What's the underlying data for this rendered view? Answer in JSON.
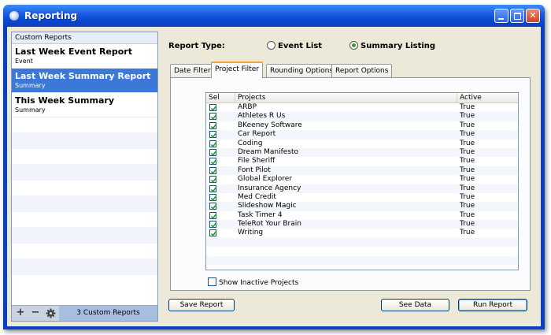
{
  "window": {
    "title": "Reporting"
  },
  "sidebar": {
    "header": "Custom Reports",
    "items": [
      {
        "name": "Last Week Event Report",
        "type": "Event",
        "selected": false
      },
      {
        "name": "Last Week Summary Report",
        "type": "Summary",
        "selected": true
      },
      {
        "name": "This Week Summary",
        "type": "Summary",
        "selected": false
      }
    ],
    "footer": {
      "count_label": "3 Custom Reports"
    }
  },
  "report_type": {
    "label": "Report Type:",
    "options": [
      {
        "label": "Event List",
        "selected": false
      },
      {
        "label": "Summary Listing",
        "selected": true
      }
    ]
  },
  "tabs": [
    {
      "label": "Date Filter",
      "active": false
    },
    {
      "label": "Project Filter",
      "active": true
    },
    {
      "label": "Rounding Options",
      "active": false
    },
    {
      "label": "Report Options",
      "active": false
    }
  ],
  "grid": {
    "columns": {
      "sel": "Sel",
      "projects": "Projects",
      "active": "Active"
    },
    "rows": [
      {
        "project": "ARBP",
        "active": "True",
        "selected": true
      },
      {
        "project": "Athletes R Us",
        "active": "True",
        "selected": true
      },
      {
        "project": "BKeeney Software",
        "active": "True",
        "selected": true
      },
      {
        "project": "Car Report",
        "active": "True",
        "selected": true
      },
      {
        "project": "Coding",
        "active": "True",
        "selected": true
      },
      {
        "project": "Dream Manifesto",
        "active": "True",
        "selected": true
      },
      {
        "project": "File Sheriff",
        "active": "True",
        "selected": true
      },
      {
        "project": "Font Pilot",
        "active": "True",
        "selected": true
      },
      {
        "project": "Global Explorer",
        "active": "True",
        "selected": true
      },
      {
        "project": "Insurance Agency",
        "active": "True",
        "selected": true
      },
      {
        "project": "Med Credit",
        "active": "True",
        "selected": true
      },
      {
        "project": "Slideshow Magic",
        "active": "True",
        "selected": true
      },
      {
        "project": "Task Timer 4",
        "active": "True",
        "selected": true
      },
      {
        "project": "TeleRot Your Brain",
        "active": "True",
        "selected": true
      },
      {
        "project": "Writing",
        "active": "True",
        "selected": true
      }
    ]
  },
  "show_inactive": {
    "label": "Show Inactive Projects",
    "checked": false
  },
  "buttons": {
    "save": "Save Report",
    "see_data": "See Data",
    "run": "Run Report"
  },
  "colors": {
    "title_bar": "#0a48d2",
    "selection": "#3b78d8",
    "active_tab_accent": "#f5a43a",
    "check": "#21a121"
  }
}
